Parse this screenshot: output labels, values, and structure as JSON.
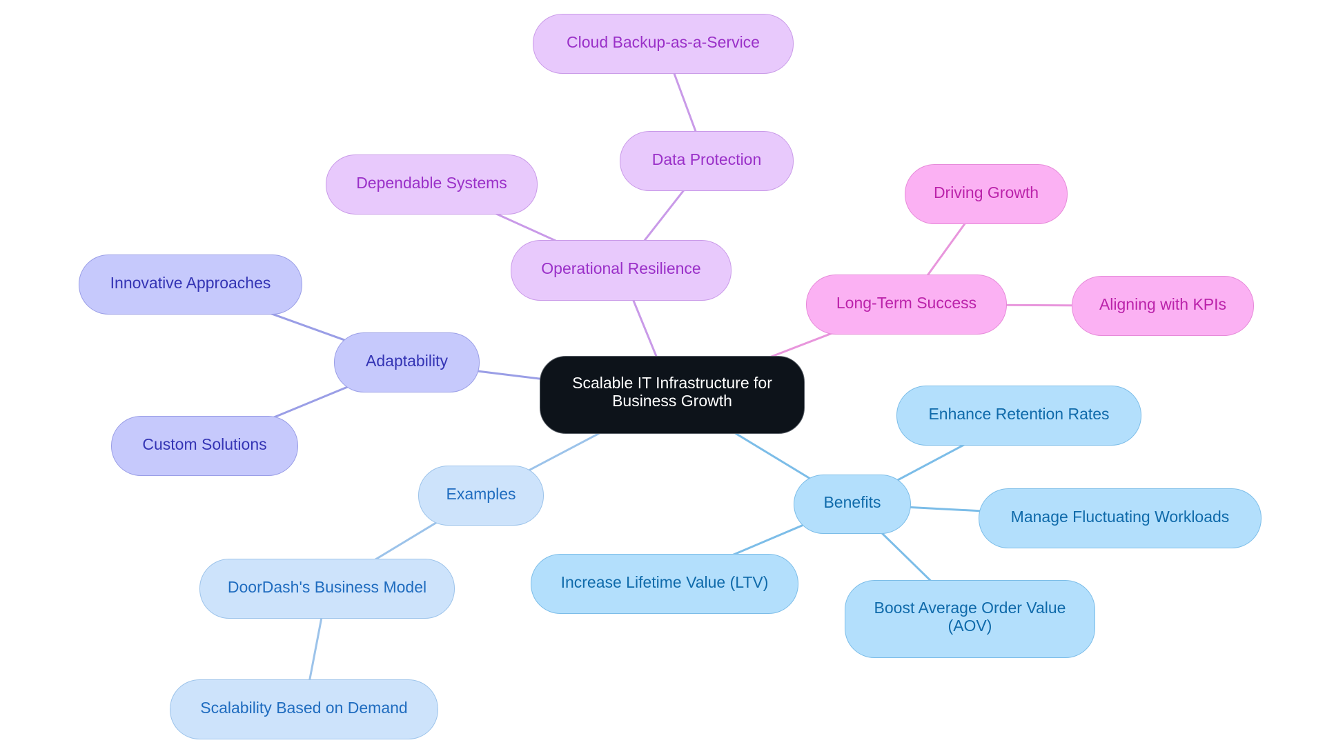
{
  "diagram": {
    "type": "mind-map",
    "root": {
      "id": "root",
      "label": "Scalable IT Infrastructure for Business Growth"
    },
    "branches": [
      {
        "id": "opres",
        "label": "Operational Resilience",
        "color_group": "purple",
        "children": [
          {
            "id": "depend",
            "label": "Dependable Systems"
          },
          {
            "id": "dataprot",
            "label": "Data Protection",
            "children": [
              {
                "id": "cloud",
                "label": "Cloud Backup-as-a-Service"
              }
            ]
          }
        ]
      },
      {
        "id": "longterm",
        "label": "Long-Term Success",
        "color_group": "pink",
        "children": [
          {
            "id": "driving",
            "label": "Driving Growth"
          },
          {
            "id": "kpis",
            "label": "Aligning with KPIs"
          }
        ]
      },
      {
        "id": "adapt",
        "label": "Adaptability",
        "color_group": "indigo",
        "children": [
          {
            "id": "innov",
            "label": "Innovative Approaches"
          },
          {
            "id": "custom",
            "label": "Custom Solutions"
          }
        ]
      },
      {
        "id": "examples",
        "label": "Examples",
        "color_group": "light-blue",
        "children": [
          {
            "id": "doordash",
            "label": "DoorDash's Business Model",
            "children": [
              {
                "id": "scal",
                "label": "Scalability Based on Demand"
              }
            ]
          }
        ]
      },
      {
        "id": "benefits",
        "label": "Benefits",
        "color_group": "sky",
        "children": [
          {
            "id": "retention",
            "label": "Enhance Retention Rates"
          },
          {
            "id": "workloads",
            "label": "Manage Fluctuating Workloads"
          },
          {
            "id": "ltv",
            "label": "Increase Lifetime Value (LTV)"
          },
          {
            "id": "aov",
            "label": "Boost Average Order Value (AOV)"
          }
        ]
      }
    ]
  },
  "labels": {
    "root": "Scalable IT Infrastructure for Business Growth",
    "opres": "Operational Resilience",
    "depend": "Dependable Systems",
    "dataprot": "Data Protection",
    "cloud": "Cloud Backup-as-a-Service",
    "longterm": "Long-Term Success",
    "driving": "Driving Growth",
    "kpis": "Aligning with KPIs",
    "adapt": "Adaptability",
    "innov": "Innovative Approaches",
    "custom": "Custom Solutions",
    "examples": "Examples",
    "doordash": "DoorDash's Business Model",
    "scal": "Scalability Based on Demand",
    "benefits": "Benefits",
    "retention": "Enhance Retention Rates",
    "workloads": "Manage Fluctuating Workloads",
    "ltv": "Increase Lifetime Value (LTV)",
    "aov": "Boost Average Order Value (AOV)"
  },
  "edges": [
    [
      "root",
      "opres"
    ],
    [
      "root",
      "longterm"
    ],
    [
      "root",
      "adapt"
    ],
    [
      "root",
      "examples"
    ],
    [
      "root",
      "benefits"
    ],
    [
      "opres",
      "depend"
    ],
    [
      "opres",
      "dataprot"
    ],
    [
      "dataprot",
      "cloud"
    ],
    [
      "longterm",
      "driving"
    ],
    [
      "longterm",
      "kpis"
    ],
    [
      "adapt",
      "innov"
    ],
    [
      "adapt",
      "custom"
    ],
    [
      "examples",
      "doordash"
    ],
    [
      "doordash",
      "scal"
    ],
    [
      "benefits",
      "retention"
    ],
    [
      "benefits",
      "workloads"
    ],
    [
      "benefits",
      "ltv"
    ],
    [
      "benefits",
      "aov"
    ]
  ],
  "colors": {
    "root_fill": "#0d131a",
    "purple_fill": "#e8c9fc",
    "purple_edge": "#c99ae8",
    "pink_fill": "#fbb1f3",
    "pink_edge": "#e896dc",
    "indigo_fill": "#c6c9fc",
    "indigo_edge": "#9a9ee6",
    "light_blue_fill": "#cde3fb",
    "light_blue_edge": "#9cc3ea",
    "sky_fill": "#b3dffc",
    "sky_edge": "#7cbde8"
  }
}
